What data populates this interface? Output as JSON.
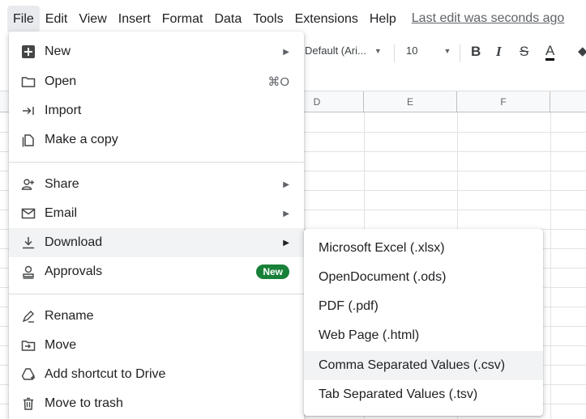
{
  "menubar": {
    "items": [
      "File",
      "Edit",
      "View",
      "Insert",
      "Format",
      "Data",
      "Tools",
      "Extensions",
      "Help"
    ],
    "last_edit": "Last edit was seconds ago"
  },
  "toolbar": {
    "font_name": "Default (Ari...",
    "font_size": "10",
    "bold": "B",
    "italic": "I",
    "strikethrough": "S",
    "text_color": "A"
  },
  "grid": {
    "columns": [
      "D",
      "E",
      "F"
    ]
  },
  "file_menu": {
    "items": [
      {
        "label": "New",
        "icon": "new-spreadsheet-icon",
        "submenu": true
      },
      {
        "label": "Open",
        "icon": "folder-icon",
        "shortcut": "⌘O"
      },
      {
        "label": "Import",
        "icon": "import-icon"
      },
      {
        "label": "Make a copy",
        "icon": "copy-icon"
      },
      {
        "label": "Share",
        "icon": "share-person-icon",
        "submenu": true
      },
      {
        "label": "Email",
        "icon": "email-icon",
        "submenu": true
      },
      {
        "label": "Download",
        "icon": "download-icon",
        "submenu": true,
        "highlighted": true
      },
      {
        "label": "Approvals",
        "icon": "approvals-icon",
        "badge": "New"
      },
      {
        "label": "Rename",
        "icon": "rename-icon"
      },
      {
        "label": "Move",
        "icon": "move-folder-icon"
      },
      {
        "label": "Add shortcut to Drive",
        "icon": "drive-shortcut-icon"
      },
      {
        "label": "Move to trash",
        "icon": "trash-icon"
      }
    ]
  },
  "download_submenu": {
    "items": [
      "Microsoft Excel (.xlsx)",
      "OpenDocument (.ods)",
      "PDF (.pdf)",
      "Web Page (.html)",
      "Comma Separated Values (.csv)",
      "Tab Separated Values (.tsv)"
    ],
    "highlighted_index": 4
  },
  "colors": {
    "badge_green": "#188038",
    "hover_bg": "#f1f3f4",
    "menu_active_bg": "#e8eaed"
  }
}
